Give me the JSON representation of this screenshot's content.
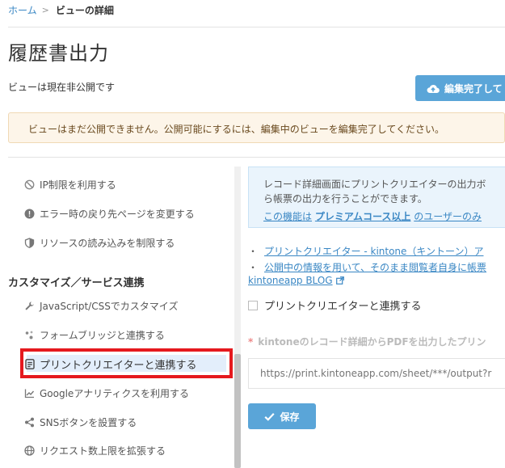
{
  "breadcrumb": {
    "home": "ホーム",
    "separator": ">",
    "current": "ビューの詳細"
  },
  "page": {
    "title": "履歴書出力",
    "status": "ビューは現在非公開です"
  },
  "header": {
    "finish_label": "編集完了して"
  },
  "alert": {
    "text": "ビューはまだ公開できません。公開可能にするには、編集中のビューを編集完了してください。"
  },
  "sidebar": {
    "items_top": [
      {
        "label": "IP制限を利用する",
        "icon": "ban-icon"
      },
      {
        "label": "エラー時の戻り先ページを変更する",
        "icon": "alert-circle-icon"
      },
      {
        "label": "リソースの読み込みを制限する",
        "icon": "shield-icon"
      }
    ],
    "section_heading": "カスタマイズ／サービス連携",
    "items_bottom": [
      {
        "label": "JavaScript/CSSでカスタマイズ",
        "icon": "wrench-icon"
      },
      {
        "label": "フォームブリッジと連携する",
        "icon": "bridge-icon"
      },
      {
        "label": "プリントクリエイターと連携する",
        "icon": "document-icon",
        "active": true
      },
      {
        "label": "Googleアナリティクスを利用する",
        "icon": "chart-icon"
      },
      {
        "label": "SNSボタンを設置する",
        "icon": "share-icon"
      },
      {
        "label": "リクエスト数上限を拡張する",
        "icon": "globe-icon"
      }
    ]
  },
  "info": {
    "line1": "レコード詳細画面にプリントクリエイターの出力ボ",
    "line2": "ら帳票の出力を行うことができます。",
    "premium_prefix": "この機能は",
    "premium_bold": "プレミアムコース以上",
    "premium_suffix": "のユーザーのみ"
  },
  "links": {
    "bullet": "・",
    "link1": "プリントクリエイター - kintone（キントーン）ア",
    "link2": "公開中の情報を用いて、そのまま閲覧者自身に帳票",
    "blog": "kintoneapp BLOG"
  },
  "form": {
    "checkbox_label": "プリントクリエイターと連携する",
    "required_mark": "*",
    "field_label": "kintoneのレコード詳細からPDFを出力したプリン",
    "url_placeholder": "https://print.kintoneapp.com/sheet/***/output?r",
    "save_label": "保存"
  },
  "colors": {
    "accent": "#5aa5d8",
    "link": "#3a87c4",
    "highlight": "#e5191e",
    "alert_bg": "#fdf5e9"
  }
}
